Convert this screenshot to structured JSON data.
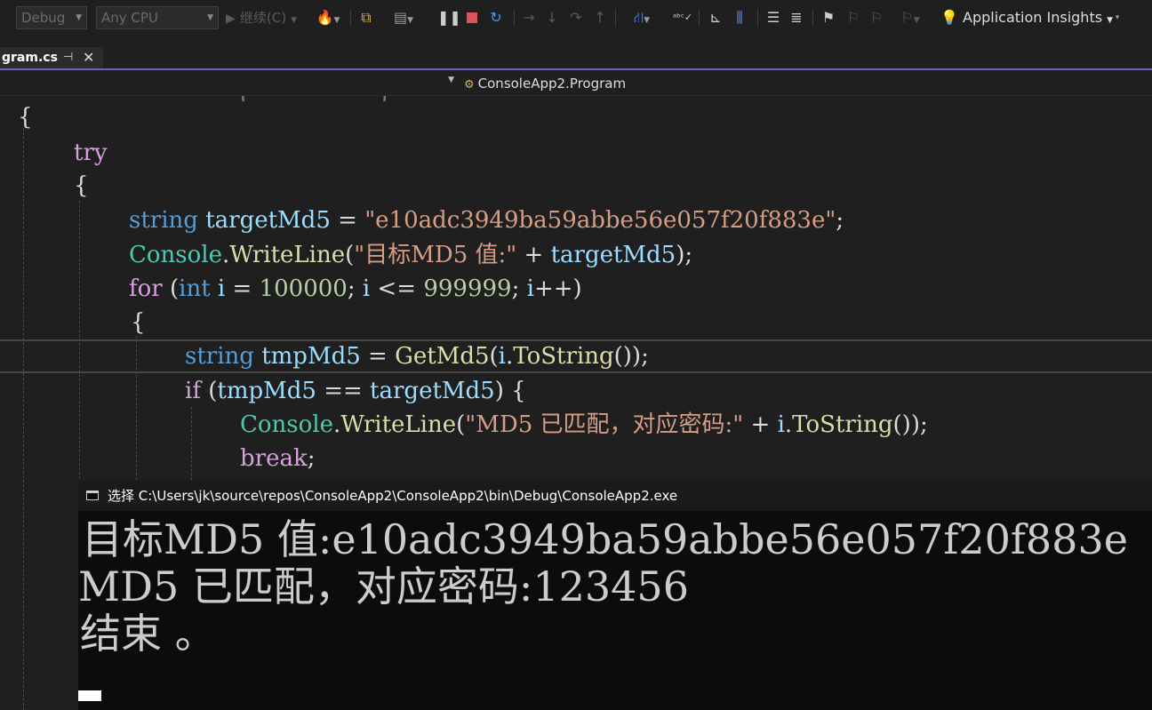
{
  "toolbar": {
    "config": "Debug",
    "platform": "Any CPU",
    "continue_label": "继续(C)",
    "insights_label": "Application Insights"
  },
  "tab": {
    "file_name": "gram.cs",
    "pin_glyph": "⊣",
    "close_glyph": "✕"
  },
  "navbar": {
    "member": "ConsoleApp2.Program"
  },
  "code": {
    "open_brace": "{",
    "try_kw": "try",
    "string_kw": "string",
    "target_var": "targetMd5",
    "eq": " = ",
    "target_str": "\"e10adc3949ba59abbe56e057f20f883e\"",
    "semi": ";",
    "console": "Console",
    "dot": ".",
    "writeline": "WriteLine",
    "lp": "(",
    "md5_label_str": "\"目标MD5 值:\"",
    "plus": " + ",
    "rp_semi": ");",
    "for_kw": "for",
    "for_lp": " (",
    "int_kw": "int",
    "i_var": "i",
    "start_num": "100000",
    "semi_sp": "; ",
    "le": " <= ",
    "end_num": "999999",
    "inc": "++",
    "rp": ")",
    "tmp_var": "tmpMd5",
    "getmd5": "GetMd5",
    "tostring": "ToString",
    "tostring_call": "());",
    "if_kw": "if",
    "eqeq": " == ",
    "rp_brace": ") {",
    "matched_str": "\"MD5 已匹配，对应密码:\"",
    "tostring_call2": "());",
    "break_kw": "break"
  },
  "console": {
    "title": "选择 C:\\Users\\jk\\source\\repos\\ConsoleApp2\\ConsoleApp2\\bin\\Debug\\ConsoleApp2.exe",
    "lines": [
      "目标MD5 值:e10adc3949ba59abbe56e057f20f883e",
      "MD5 已匹配，对应密码:123456",
      "结束 。"
    ]
  }
}
